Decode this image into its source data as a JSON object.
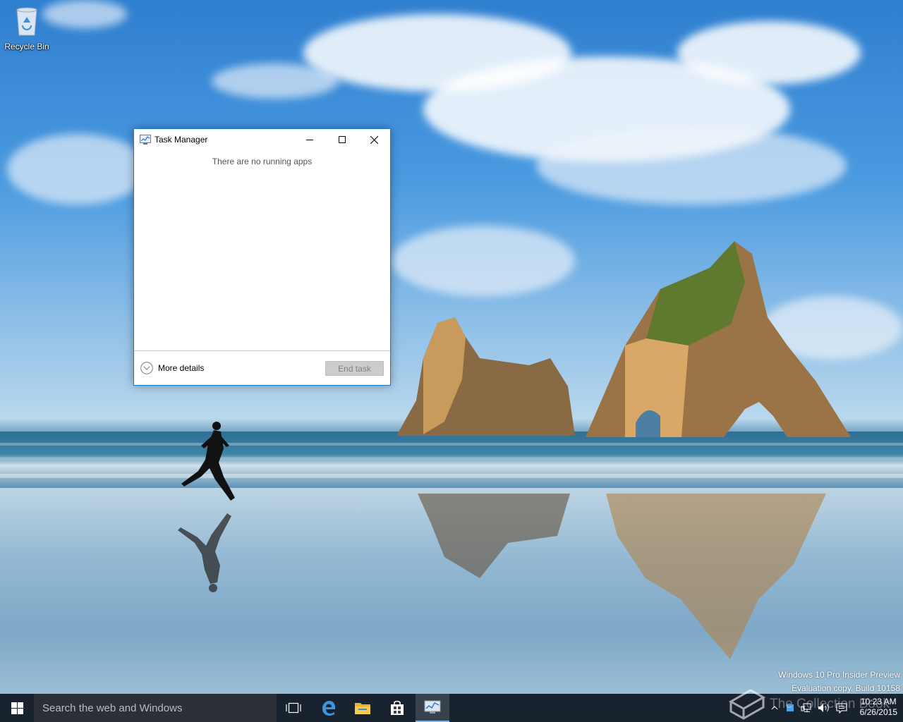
{
  "desktop": {
    "icons": [
      {
        "label": "Recycle Bin",
        "icon": "recycle-bin-icon"
      }
    ],
    "watermark": {
      "line1": "Windows 10 Pro Insider Preview",
      "line2": "Evaluation copy. Build 10158"
    },
    "overlay_text": "The Collection Book"
  },
  "task_manager": {
    "title": "Task Manager",
    "empty_message": "There are no running apps",
    "more_details_label": "More details",
    "end_task_label": "End task",
    "end_task_enabled": false,
    "accent_color": "#1979ca"
  },
  "taskbar": {
    "search_placeholder": "Search the web and Windows",
    "pinned": [
      {
        "name": "task-view",
        "icon": "task-view-icon"
      },
      {
        "name": "edge",
        "icon": "edge-icon"
      },
      {
        "name": "file-explorer",
        "icon": "folder-icon"
      },
      {
        "name": "store",
        "icon": "store-icon"
      },
      {
        "name": "task-manager",
        "icon": "task-manager-icon",
        "active": true
      }
    ],
    "clock": {
      "time": "10:23 AM",
      "date": "6/26/2015"
    }
  }
}
